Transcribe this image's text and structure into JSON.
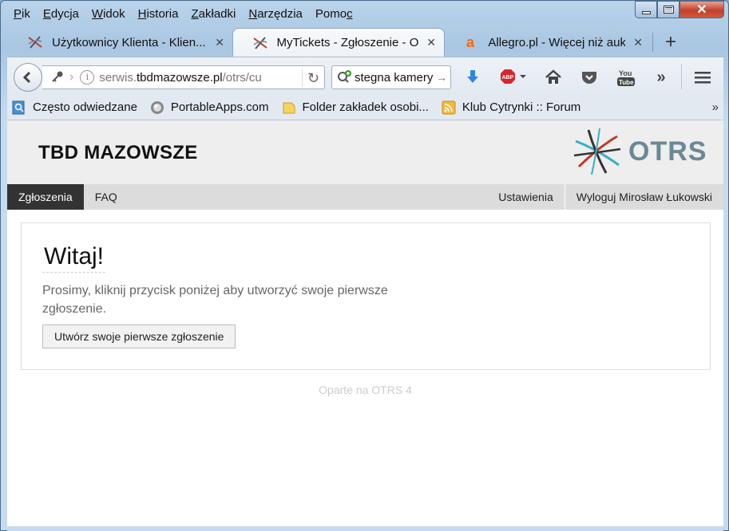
{
  "menubar": {
    "items": [
      {
        "label": "Plik",
        "u": "P"
      },
      {
        "label": "Edycja",
        "u": "E"
      },
      {
        "label": "Widok",
        "u": "W"
      },
      {
        "label": "Historia",
        "u": "H"
      },
      {
        "label": "Zakładki",
        "u": "Z"
      },
      {
        "label": "Narzędzia",
        "u": "N"
      },
      {
        "label": "Pomoc",
        "u": "c"
      }
    ]
  },
  "tabs": [
    {
      "label": "Użytkownicy Klienta - Klien...",
      "icon": "otrs-icon",
      "active": false
    },
    {
      "label": "MyTickets - Zgłoszenie - O...",
      "icon": "otrs-icon",
      "active": true
    },
    {
      "label": "Allegro.pl - Więcej niż auk...",
      "icon": "allegro-icon",
      "active": false
    }
  ],
  "newtab_label": "+",
  "close_glyph": "✕",
  "urlbar": {
    "prefix": "serwis.",
    "domain": "tbdmazowsze.pl",
    "path": "/otrs/cu"
  },
  "search": {
    "text": "stegna kamery"
  },
  "bookmarks": [
    {
      "label": "Często odwiedzane",
      "icon": "recent-icon"
    },
    {
      "label": "PortableApps.com",
      "icon": "portableapps-icon"
    },
    {
      "label": "Folder zakładek osobi...",
      "icon": "folder-icon"
    },
    {
      "label": "Klub Cytrynki :: Forum",
      "icon": "rss-icon"
    }
  ],
  "bookmarks_more": "»",
  "page": {
    "site_title": "TBD MAZOWSZE",
    "logo_text": "OTRS",
    "nav_left": [
      "Zgłoszenia",
      "FAQ"
    ],
    "nav_right": [
      "Ustawienia",
      "Wyloguj Mirosław Łukowski"
    ],
    "welcome_title": "Witaj!",
    "welcome_text": "Prosimy, kliknij przycisk poniżej aby utworzyć swoje pierwsze zgłoszenie.",
    "create_button": "Utwórz swoje pierwsze zgłoszenie",
    "powered_by": "Oparte na OTRS 4"
  },
  "colors": {
    "accent_dark": "#333333",
    "otrs_blue": "#6b8896",
    "otrs_red": "#c0392b"
  }
}
